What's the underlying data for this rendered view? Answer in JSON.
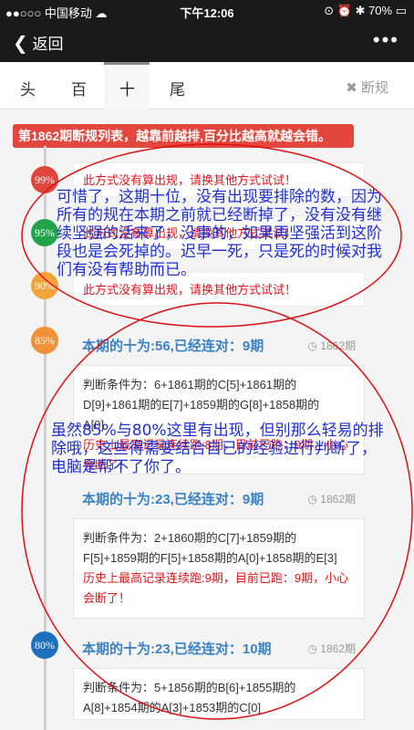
{
  "statusbar": {
    "left": "●●○○○ 中国移动 ☁",
    "time": "下午12:06",
    "right": "⊙ ⏰ ✱ 70% ▭"
  },
  "navbar": {
    "back": "返回",
    "more": "•••"
  },
  "tabs": [
    "头",
    "百",
    "十",
    "尾"
  ],
  "rule_label": "断规",
  "banner": "第1862期断规列表，越靠前越排,百分比越高就越会错。",
  "msgs": [
    {
      "percent": "99%",
      "text": "此方式没有算出规，请换其他方式试试！",
      "color": "#e0463c"
    },
    {
      "percent": "95%",
      "text": "此方式没有算出规，请换其他方式试试！",
      "color": "#23a44b"
    },
    {
      "percent": "90%",
      "text": "此方式没有算出规，请换其他方式试试！",
      "color": "#f2a33a"
    }
  ],
  "cards": [
    {
      "percent": "85%",
      "color": "#f2913a",
      "title": "本期的十为:56,已经连对：9期",
      "period": "1862期",
      "body": [
        "判断条件为：6+1861期的C[5]+1861期的",
        "D[9]+1861期的E[7]+1859期的G[8]+1858期的",
        "A[0]"
      ],
      "warn": "历史上最高记录连续跑:8期，目前已跑：9期，小心会断了！"
    },
    {
      "percent": "80%",
      "color": "#1f6fbf",
      "title": "本期的十为:23,已经连对：9期",
      "period": "1862期",
      "body": [
        "判断条件为：2+1860期的C[7]+1859期的",
        "F[5]+1859期的F[5]+1858期的A[0]+1858期的E[3]"
      ],
      "warn": "历史上最高记录连续跑:9期，目前已跑：9期，小心会断了！"
    },
    {
      "percent": "80%",
      "color": "#1f6fbf",
      "title": "本期的十为:23,已经连对：10期",
      "period": "1862期",
      "body": [
        "判断条件为：5+1856期的B[6]+1855期的",
        "A[8]+1854期的A[3]+1853期的C[0]"
      ],
      "warn": ""
    }
  ],
  "notes": {
    "first": "可惜了，这期十位，没有出现要排除的数，因为所有的规在本期之前就已经断掉了，没有没有继续坚强的活来了，没事的，如果再坚强活到这阶段也是会死掉的。迟早一死，只是死的时候对我们有没有帮助而已。",
    "second": "虽然85%与80%这里有出现，但别那么轻易的排除哦，这些得需要结合自已的经验进行判断了，电脑是帮不了你了。"
  }
}
